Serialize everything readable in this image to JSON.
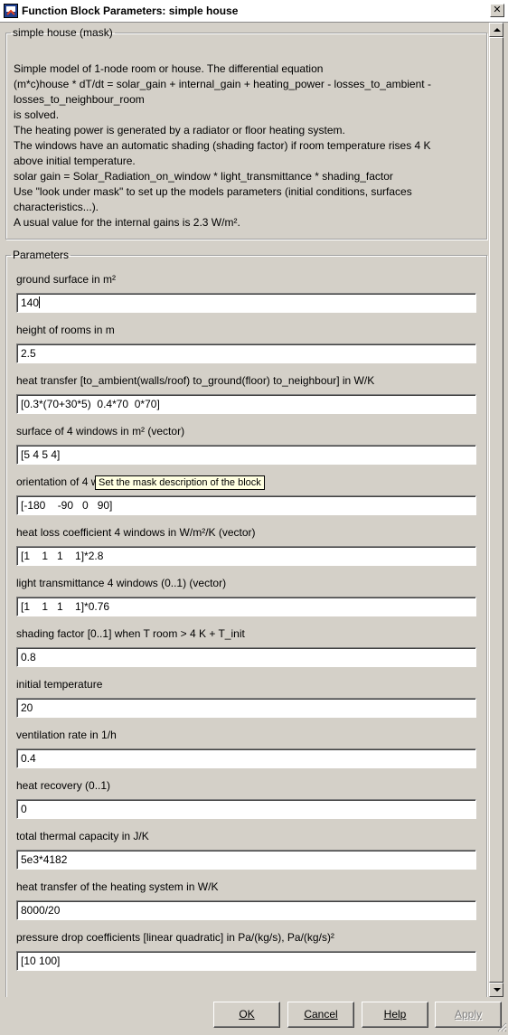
{
  "window": {
    "title": "Function Block Parameters: simple house",
    "close_glyph": "✕"
  },
  "mask_group": {
    "legend": "simple house (mask)",
    "description": "Simple model of 1-node room or house. The differential equation\n(m*c)house * dT/dt = solar_gain + internal_gain + heating_power - losses_to_ambient -\nlosses_to_neighbour_room\nis solved.\nThe heating power is generated by a radiator or floor heating system.\nThe windows have an automatic shading (shading factor) if room temperature rises 4 K\nabove initial temperature.\nsolar gain = Solar_Radiation_on_window * light_transmittance * shading_factor\nUse \"look under mask\" to set up the models parameters (initial conditions, surfaces\ncharacteristics...).\nA usual value for the internal gains is 2.3 W/m²."
  },
  "parameters": {
    "legend": "Parameters",
    "items": [
      {
        "label": "ground surface in m²",
        "value": "140"
      },
      {
        "label": "height of rooms in m",
        "value": "2.5"
      },
      {
        "label": "heat transfer [to_ambient(walls/roof)  to_ground(floor)  to_neighbour] in W/K",
        "value": "[0.3*(70+30*5)  0.4*70  0*70]"
      },
      {
        "label": "surface of 4 windows in m² (vector)",
        "value": "[5 4 5 4]"
      },
      {
        "label": "orientation of 4 windows (south 0, west 90)",
        "value": "[-180    -90   0   90]"
      },
      {
        "label": "heat loss coefficient 4 windows in W/m²/K (vector)",
        "value": "[1    1   1    1]*2.8"
      },
      {
        "label": "light transmittance 4 windows (0..1) (vector)",
        "value": "[1    1   1    1]*0.76"
      },
      {
        "label": "shading factor [0..1] when T room > 4 K + T_init",
        "value": "0.8"
      },
      {
        "label": "initial temperature",
        "value": "20"
      },
      {
        "label": "ventilation rate in 1/h",
        "value": "0.4"
      },
      {
        "label": "heat recovery (0..1)",
        "value": "0"
      },
      {
        "label": "total thermal capacity in J/K",
        "value": "5e3*4182"
      },
      {
        "label": "heat transfer of the heating system in W/K",
        "value": "8000/20"
      },
      {
        "label": "pressure drop coefficients [linear quadratic] in Pa/(kg/s), Pa/(kg/s)²",
        "value": "[10 100]"
      }
    ]
  },
  "tooltip": "Set the mask description of the block",
  "buttons": {
    "ok": "OK",
    "cancel": "Cancel",
    "help": "Help",
    "apply": "Apply"
  },
  "colors": {
    "dialog_bg": "#d4d0c8",
    "tooltip_bg": "#ffffe1",
    "disabled_text": "#808080"
  }
}
